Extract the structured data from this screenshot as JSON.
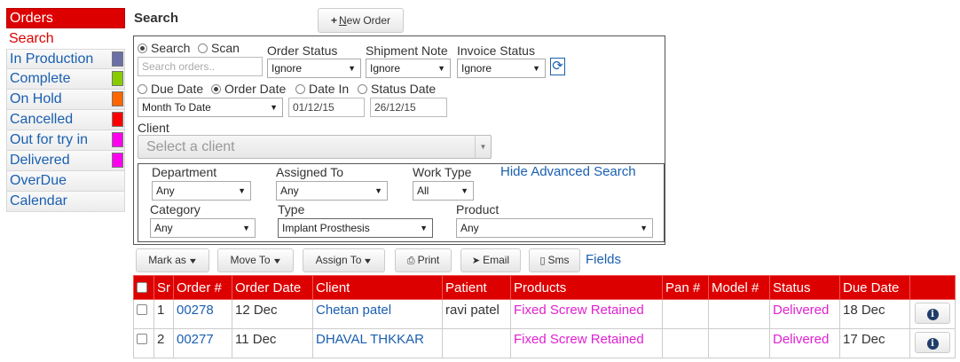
{
  "sidebar": {
    "header": "Orders",
    "search": "Search",
    "items": [
      {
        "label": "In Production",
        "color": "#6a70a6"
      },
      {
        "label": "Complete",
        "color": "#88cc00"
      },
      {
        "label": "On Hold",
        "color": "#ff6600"
      },
      {
        "label": "Cancelled",
        "color": "#ff0000"
      },
      {
        "label": "Out for try in",
        "color": "#ff00ee"
      },
      {
        "label": "Delivered",
        "color": "#ff00ee"
      },
      {
        "label": "OverDue",
        "color": null
      },
      {
        "label": "Calendar",
        "color": null
      }
    ]
  },
  "header": {
    "title": "Search",
    "new_order_first": "N",
    "new_order_rest": "ew Order"
  },
  "search": {
    "mode_search": "Search",
    "mode_scan": "Scan",
    "search_placeholder": "Search orders..",
    "order_status_label": "Order Status",
    "order_status_value": "Ignore",
    "shipment_note_label": "Shipment Note",
    "shipment_note_value": "Ignore",
    "invoice_status_label": "Invoice Status",
    "invoice_status_value": "Ignore",
    "date_due": "Due Date",
    "date_order": "Order Date",
    "date_in": "Date In",
    "date_status": "Status Date",
    "date_range_value": "Month To Date",
    "date_from": "01/12/15",
    "date_to": "26/12/15",
    "client_label": "Client",
    "client_placeholder": "Select a client"
  },
  "advanced": {
    "department_label": "Department",
    "department_value": "Any",
    "assigned_to_label": "Assigned To",
    "assigned_to_value": "Any",
    "work_type_label": "Work Type",
    "work_type_value": "All",
    "hide_link": "Hide Advanced Search",
    "category_label": "Category",
    "category_value": "Any",
    "type_label": "Type",
    "type_value": "Implant Prosthesis",
    "product_label": "Product",
    "product_value": "Any"
  },
  "actions": {
    "mark_as": "Mark as",
    "move_to": "Move To",
    "assign_to": "Assign To",
    "print": "Print",
    "email": "Email",
    "sms": "Sms",
    "fields": "Fields"
  },
  "table": {
    "columns": [
      "Sr",
      "Order #",
      "Order Date",
      "Client",
      "Patient",
      "Products",
      "Pan #",
      "Model #",
      "Status",
      "Due Date"
    ],
    "rows": [
      {
        "sr": "1",
        "order": "00278",
        "order_date": "12 Dec",
        "client": "Chetan patel",
        "patient": "ravi patel",
        "products": "Fixed Screw Retained",
        "pan": "",
        "model": "",
        "status": "Delivered",
        "due_date": "18 Dec"
      },
      {
        "sr": "2",
        "order": "00277",
        "order_date": "11 Dec",
        "client": "DHAVAL THKKAR",
        "patient": "",
        "products": "Fixed Screw Retained",
        "pan": "",
        "model": "",
        "status": "Delivered",
        "due_date": "17 Dec"
      }
    ]
  },
  "colors": {
    "accent_red": "#dd0000",
    "link_blue": "#1a5fb0",
    "magenta": "#e020d0"
  }
}
